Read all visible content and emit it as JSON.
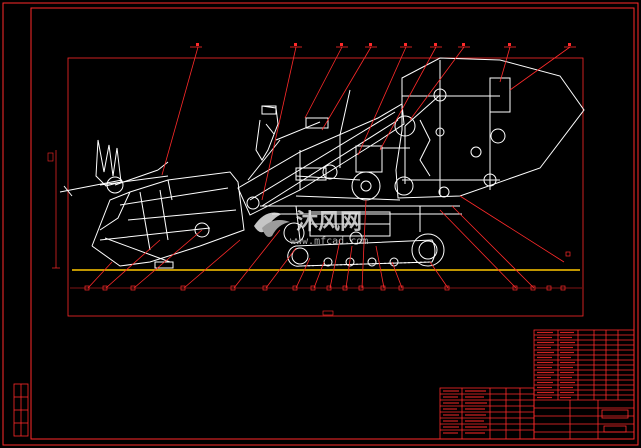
{
  "drawing": {
    "type": "mechanical-assembly-drawing",
    "subject": "combine-harvester-side-view",
    "colors": {
      "background": "#000000",
      "frame": "#ff2a2a",
      "machine": "#ffffff",
      "ground": "#ffc800",
      "leader": "#ff2a2a"
    },
    "top_callouts": 8,
    "bottom_callouts": 20,
    "title_block_rows": 14
  },
  "watermark": {
    "brand": "沐风网",
    "url": "www.mfcad.com",
    "logo_icon": "mf-logo-icon"
  }
}
